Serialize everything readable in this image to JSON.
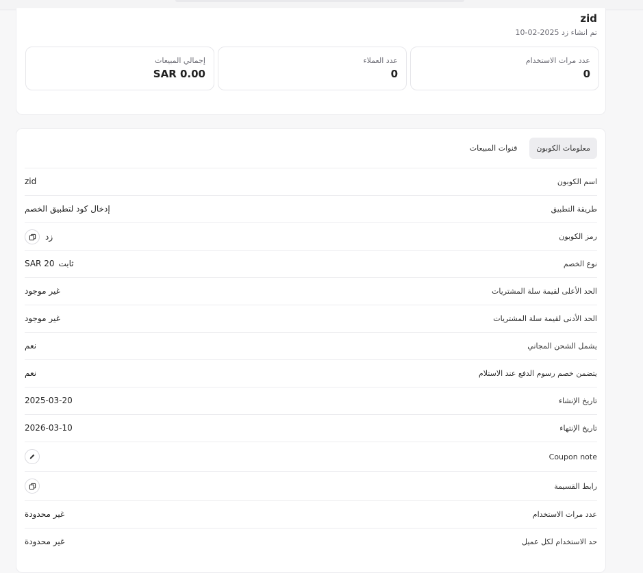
{
  "coupon": {
    "name": "zid",
    "created_label": "تم انشاء زد 2025-02-10"
  },
  "stats": [
    {
      "label": "عدد مرات الاستخدام",
      "value": "0"
    },
    {
      "label": "عدد العملاء",
      "value": "0"
    },
    {
      "label": "إجمالي المبيعات",
      "value": "SAR 0.00"
    }
  ],
  "tabs": [
    {
      "label": "معلومات الكوبون"
    },
    {
      "label": "قنوات المبيعات"
    }
  ],
  "rows": {
    "coupon_name": {
      "label": "اسم الكوبون",
      "value": "zid"
    },
    "apply_method": {
      "label": "طريقة التطبيق",
      "value": "إدخال كود لتطبيق الخصم"
    },
    "coupon_code": {
      "label": "رمز الكوبون",
      "value": "زد"
    },
    "discount_type": {
      "label": "نوع الخصم",
      "type": "ثابت",
      "amount": "SAR 20"
    },
    "max_cart": {
      "label": "الحد الأعلى لقيمة سلة المشتريات",
      "value": "غير موجود"
    },
    "min_cart": {
      "label": "الحد الأدنى لقيمة سلة المشتريات",
      "value": "غير موجود"
    },
    "free_shipping": {
      "label": "يشمل الشحن المجاني",
      "value": "نعم"
    },
    "cod_fee": {
      "label": "يتضمن خصم رسوم الدفع عند الاستلام",
      "value": "نعم"
    },
    "created_date": {
      "label": "تاريخ الإنشاء",
      "value": "2025-03-20"
    },
    "end_date": {
      "label": "تاريخ الإنتهاء",
      "value": "2026-03-10"
    },
    "coupon_note": {
      "label": "Coupon note"
    },
    "voucher_link": {
      "label": "رابط القسيمة"
    },
    "usage_count": {
      "label": "عدد مرات الاستخدام",
      "value": "غير محدودة"
    },
    "per_customer": {
      "label": "حد الاستخدام لكل عميل",
      "value": "غير محدودة"
    }
  },
  "icons": {
    "copy": "copy-icon",
    "edit": "pencil-icon"
  }
}
